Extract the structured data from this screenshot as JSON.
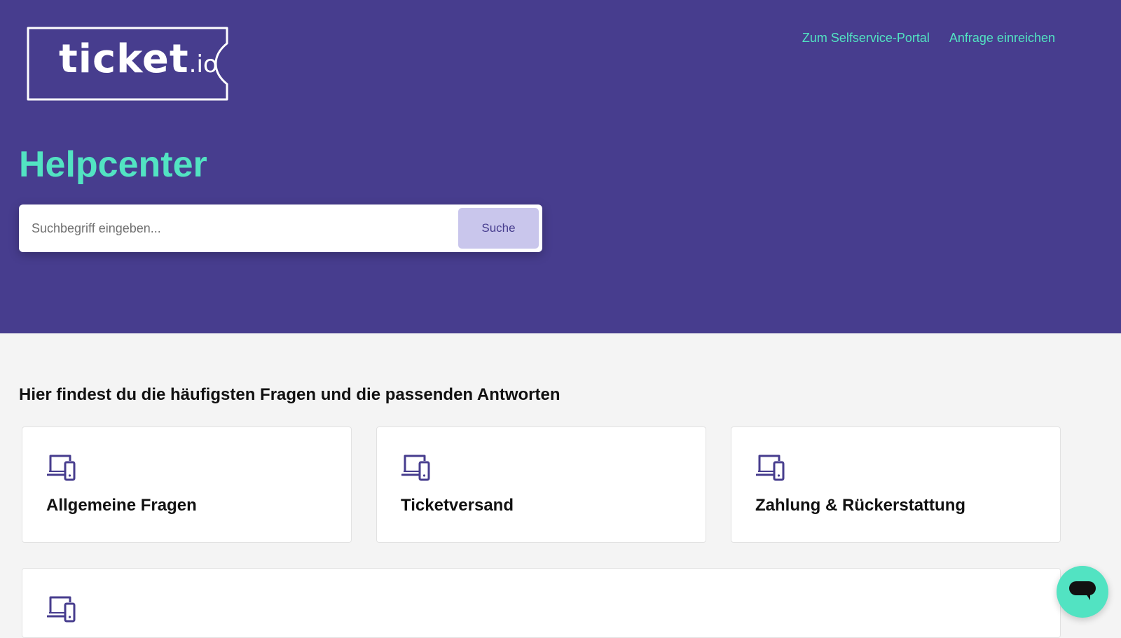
{
  "brand": {
    "logo_main": "ticket",
    "logo_sub": ".io"
  },
  "nav": {
    "selfservice": "Zum Selfservice-Portal",
    "request": "Anfrage einreichen"
  },
  "hero": {
    "title": "Helpcenter"
  },
  "search": {
    "placeholder": "Suchbegriff eingeben...",
    "button_label": "Suche"
  },
  "faq": {
    "heading": "Hier findest du die häufigsten Fragen und die passenden Antworten",
    "categories": [
      {
        "icon": "devices-icon",
        "label": "Allgemeine Fragen"
      },
      {
        "icon": "devices-icon",
        "label": "Ticketversand"
      },
      {
        "icon": "devices-icon",
        "label": "Zahlung & Rückerstattung"
      },
      {
        "icon": "devices-icon",
        "label": ""
      }
    ]
  },
  "chat": {
    "icon": "chat-bubble-icon"
  },
  "colors": {
    "hero_bg": "#473d8e",
    "accent": "#52e3c2",
    "search_button_bg": "#c9c6ec",
    "page_bg": "#f4f4f4",
    "card_bg": "#ffffff"
  }
}
